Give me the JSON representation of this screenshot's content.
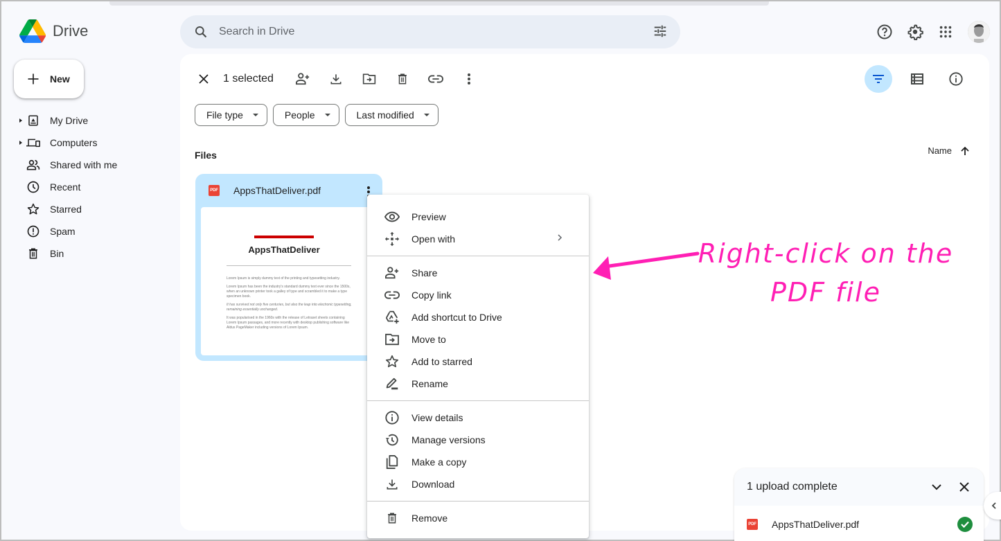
{
  "app": {
    "name": "Drive"
  },
  "search": {
    "placeholder": "Search in Drive",
    "value": ""
  },
  "header_icons": [
    "help-icon",
    "settings-icon",
    "apps-grid-icon",
    "account-avatar"
  ],
  "sidebar": {
    "new_label": "New",
    "items": [
      {
        "label": "My Drive",
        "icon": "my-drive-icon",
        "expandable": true
      },
      {
        "label": "Computers",
        "icon": "computers-icon",
        "expandable": true
      },
      {
        "label": "Shared with me",
        "icon": "shared-icon",
        "expandable": false
      },
      {
        "label": "Recent",
        "icon": "clock-icon",
        "expandable": false
      },
      {
        "label": "Starred",
        "icon": "star-icon",
        "expandable": false
      },
      {
        "label": "Spam",
        "icon": "spam-icon",
        "expandable": false
      },
      {
        "label": "Bin",
        "icon": "trash-icon",
        "expandable": false
      }
    ]
  },
  "selection_bar": {
    "count_label": "1 selected",
    "actions": [
      "clear-selection",
      "share",
      "download",
      "move",
      "delete",
      "copy-link",
      "more-actions"
    ]
  },
  "filters": [
    {
      "label": "File type"
    },
    {
      "label": "People"
    },
    {
      "label": "Last modified"
    }
  ],
  "section": {
    "title": "Files",
    "sort_label": "Name",
    "sort_direction": "ascending"
  },
  "files": [
    {
      "name": "AppsThatDeliver.pdf",
      "type_badge": "PDF",
      "selected": true,
      "preview": {
        "title": "AppsThatDeliver",
        "paragraphs": [
          "Lorem Ipsum is simply dummy text of the printing and typesetting industry.",
          "Lorem Ipsum has been the industry's standard dummy text ever since the 1500s, when an unknown printer took a galley of type and scrambled it to make a type specimen book.",
          "It has survived not only five centuries, but also the leap into electronic typesetting, remaining essentially unchanged.",
          "It was popularised in the 1960s with the release of Letraset sheets containing Lorem Ipsum passages, and more recently with desktop publishing software like Aldus PageMaker including versions of Lorem Ipsum."
        ]
      }
    }
  ],
  "context_menu": {
    "groups": [
      [
        {
          "label": "Preview",
          "icon": "eye-icon"
        },
        {
          "label": "Open with",
          "icon": "open-with-icon",
          "submenu": true
        }
      ],
      [
        {
          "label": "Share",
          "icon": "share-person-icon"
        },
        {
          "label": "Copy link",
          "icon": "link-icon"
        },
        {
          "label": "Add shortcut to Drive",
          "icon": "add-shortcut-icon"
        },
        {
          "label": "Move to",
          "icon": "move-folder-icon"
        },
        {
          "label": "Add to starred",
          "icon": "star-icon"
        },
        {
          "label": "Rename",
          "icon": "rename-pencil-icon"
        }
      ],
      [
        {
          "label": "View details",
          "icon": "info-icon"
        },
        {
          "label": "Manage versions",
          "icon": "history-icon"
        },
        {
          "label": "Make a copy",
          "icon": "copy-icon"
        },
        {
          "label": "Download",
          "icon": "download-icon"
        }
      ],
      [
        {
          "label": "Remove",
          "icon": "trash-icon"
        }
      ]
    ]
  },
  "annotation": {
    "text_line1": "Right-click on the",
    "text_line2": "PDF file",
    "color": "#ff1fb4"
  },
  "upload_panel": {
    "title": "1 upload complete",
    "items": [
      {
        "name": "AppsThatDeliver.pdf",
        "type_badge": "PDF",
        "status": "complete"
      }
    ]
  },
  "colors": {
    "accent_selected": "#c2e7ff",
    "pdf_red": "#ea4335",
    "success_green": "#1e8e3e",
    "search_bg": "#e9eef6"
  }
}
